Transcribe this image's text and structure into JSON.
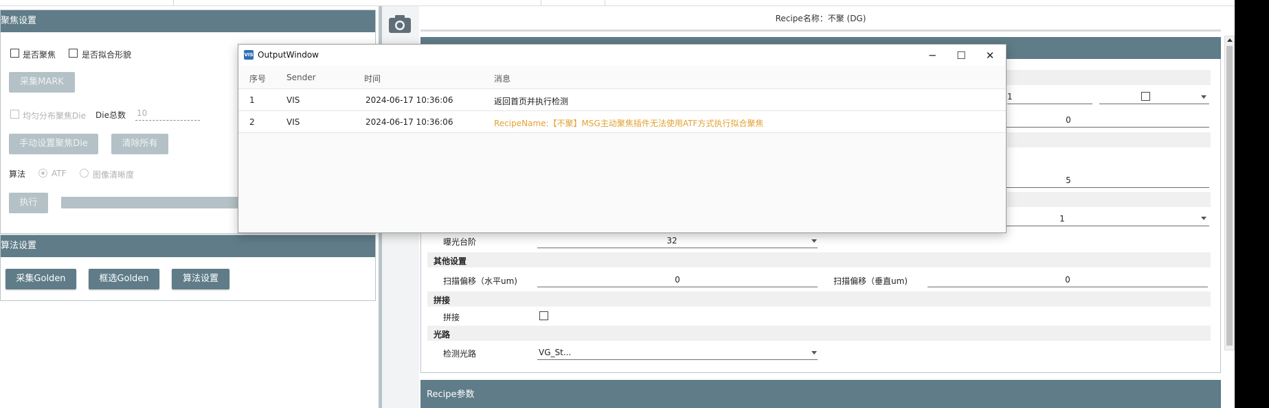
{
  "left": {
    "focus_title": "聚焦设置",
    "chk_focus": "是否聚焦",
    "chk_fit": "是否拟合形貌",
    "btn_mark": "采集MARK",
    "chk_even": "均匀分布聚焦Die",
    "die_total_label": "Die总数",
    "die_total_value": "10",
    "btn_manual": "手动设置聚焦Die",
    "btn_clear": "清除所有",
    "algo_label": "算法",
    "radio_atf": "ATF",
    "radio_clarity": "图像清晰度",
    "btn_exec": "执行",
    "algo_title": "算法设置",
    "btn_golden": "采集Golden",
    "btn_select_golden": "框选Golden",
    "btn_algo_settings": "算法设置"
  },
  "right": {
    "recipe_name": "Recipe名称：不聚 (DG)",
    "row1_value": "1",
    "row2_value": "0",
    "row3_value": "5",
    "row4_value": "1",
    "exposure_label": "曝光台阶",
    "exposure_value": "32",
    "other_section": "其他设置",
    "scan_h_label": "扫描偏移（水平um)",
    "scan_h_value": "0",
    "scan_v_label": "扫描偏移（垂直um)",
    "scan_v_value": "0",
    "stitch_section": "拼接",
    "stitch_label": "拼接",
    "light_section": "光路",
    "light_label": "检测光路",
    "light_value": "VG_St...",
    "recipe_params": "Recipe参数"
  },
  "output": {
    "title": "OutputWindow",
    "logo": "VIS",
    "headers": {
      "no": "序号",
      "sender": "Sender",
      "time": "时间",
      "msg": "消息"
    },
    "rows": [
      {
        "no": "1",
        "sender": "VIS",
        "time": "2024-06-17 10:36:06",
        "msg": "返回首页并执行检测"
      },
      {
        "no": "2",
        "sender": "VIS",
        "time": "2024-06-17 10:36:06",
        "msg": "RecipeName:【不聚】MSG主动聚焦插件无法使用ATF方式执行拟合聚焦"
      }
    ],
    "minimize": "─",
    "maximize": "☐",
    "close": "✕"
  },
  "colors": {
    "header": "#5f7c88",
    "warn": "#e3a233"
  }
}
